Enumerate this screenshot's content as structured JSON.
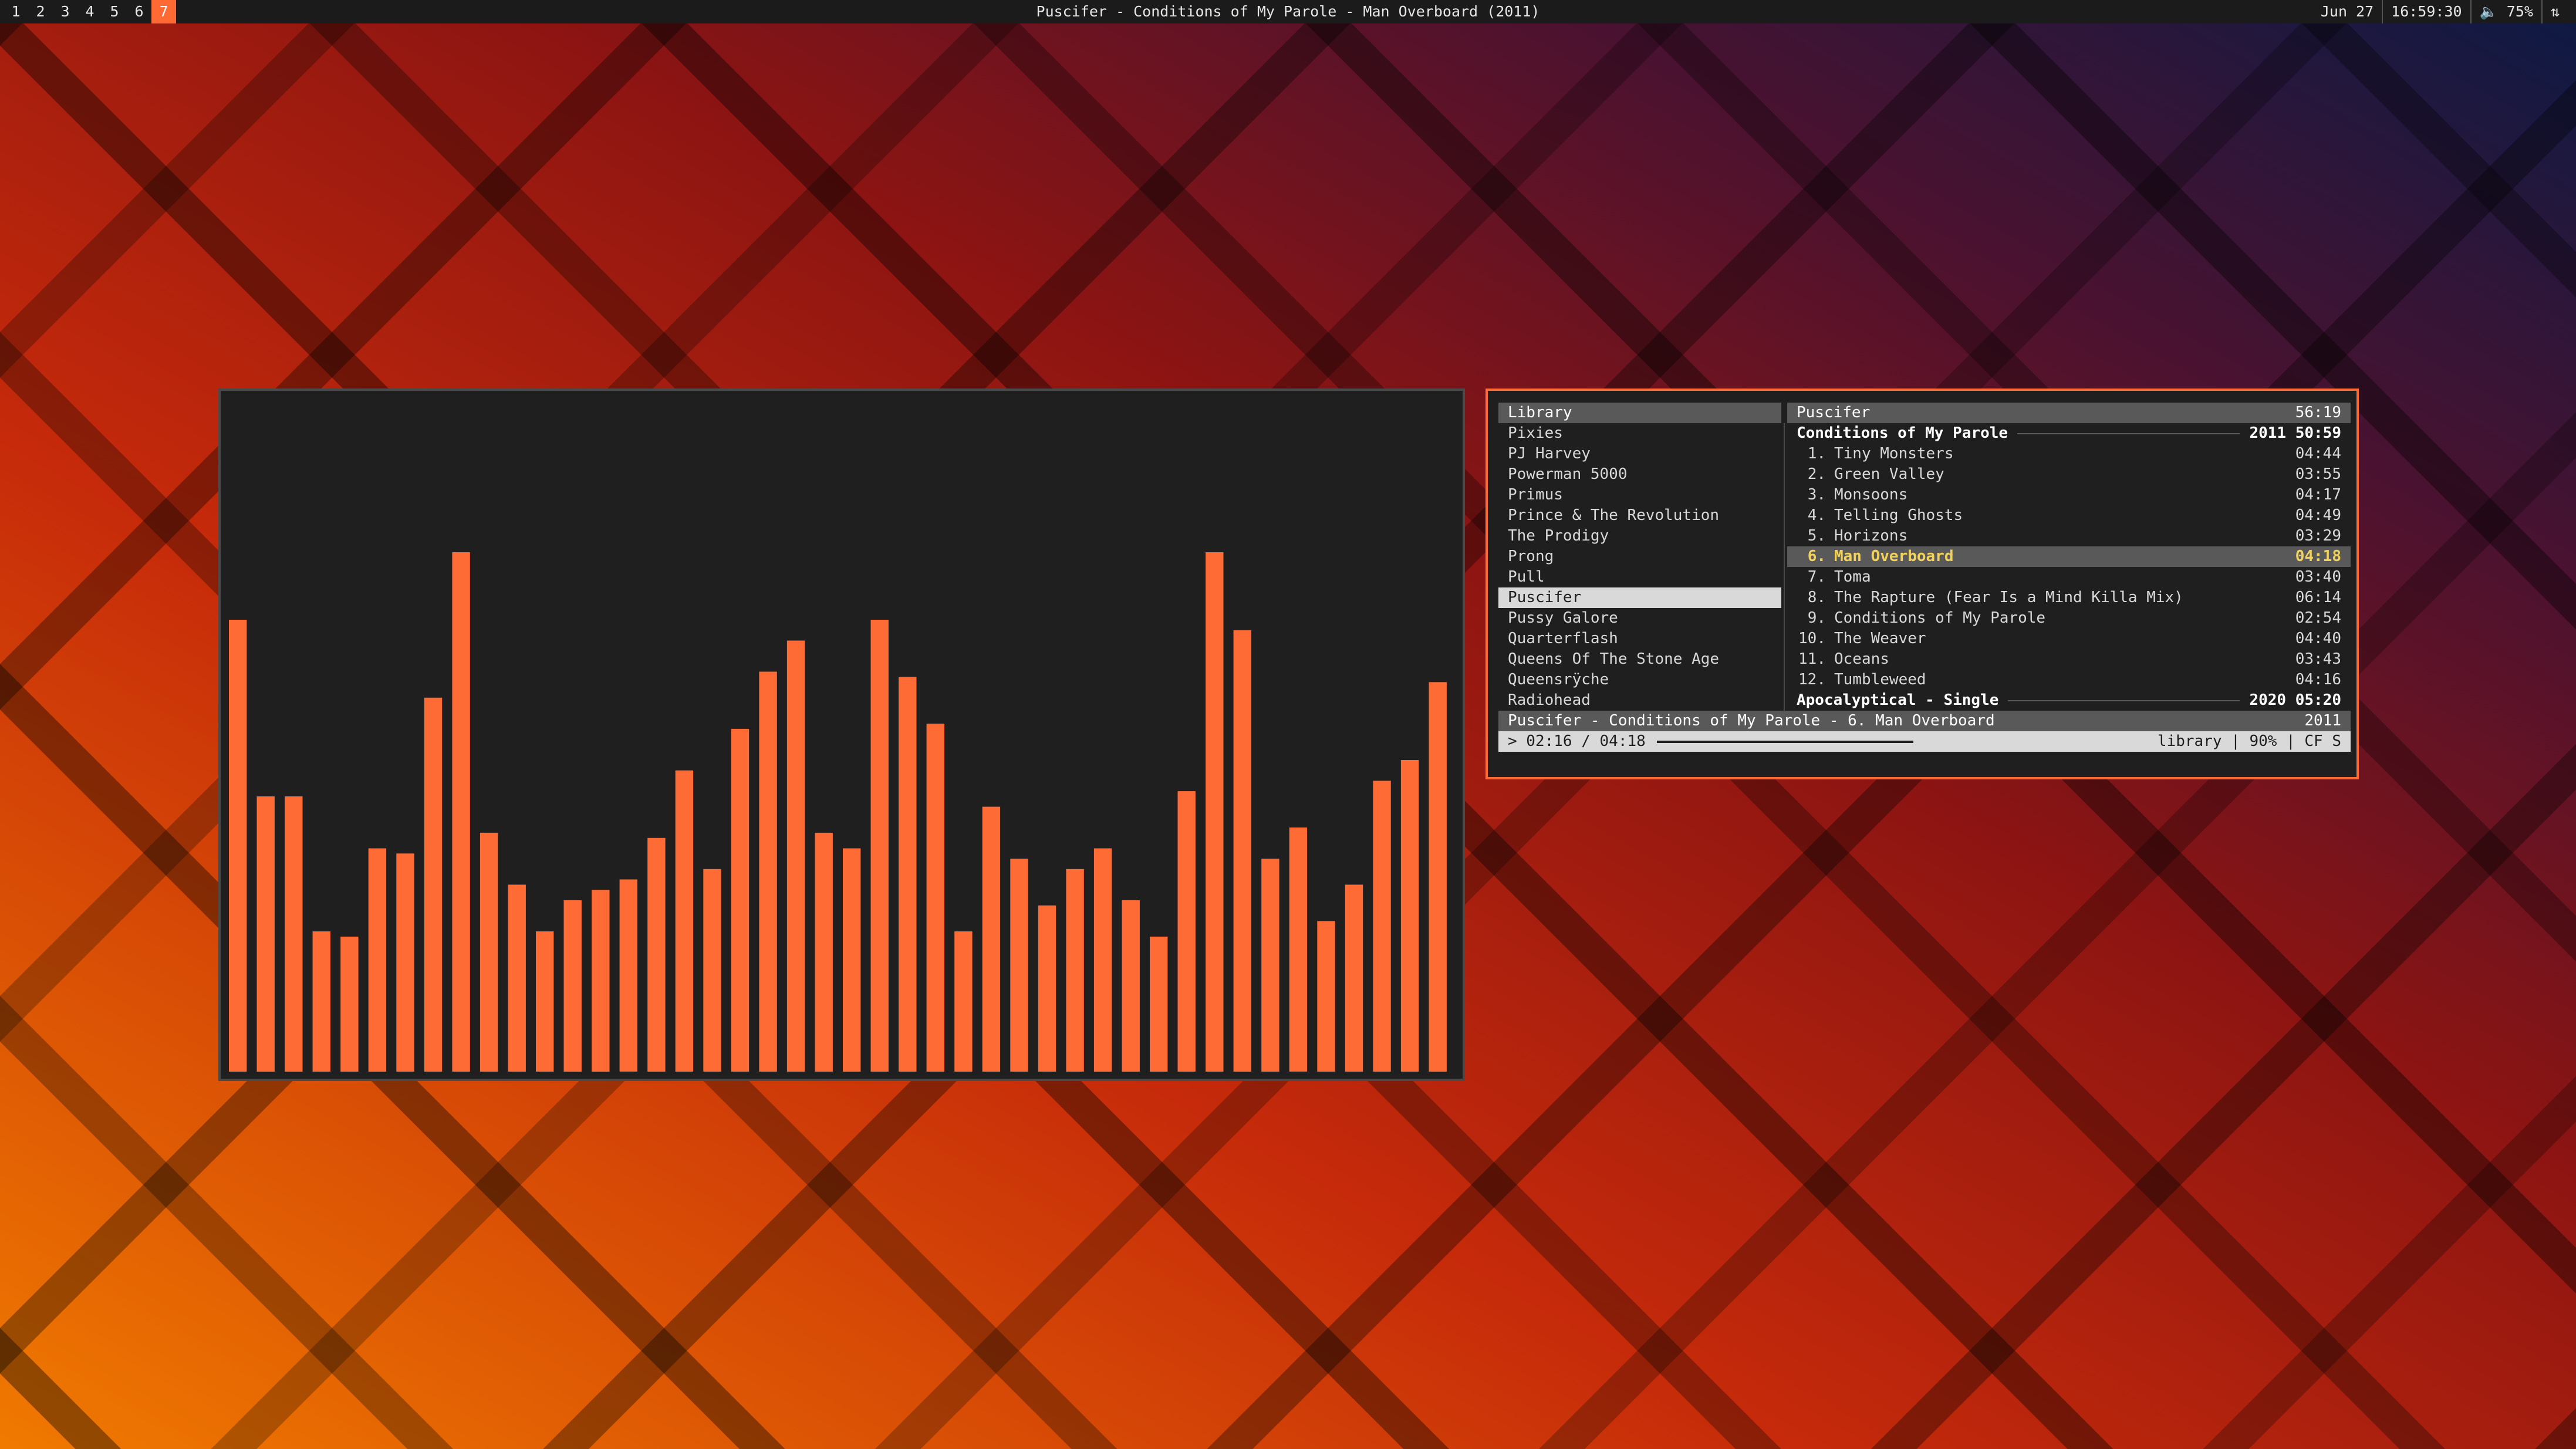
{
  "topbar": {
    "workspaces": [
      "1",
      "2",
      "3",
      "4",
      "5",
      "6",
      "7"
    ],
    "active_workspace": "7",
    "window_title": "Puscifer - Conditions of My Parole - Man Overboard (2011)",
    "date": "Jun 27",
    "time": "16:59:30",
    "volume": "75%",
    "volume_icon": "speaker-icon",
    "tray_icon": "network-icon"
  },
  "colors": {
    "accent": "#ff6a34",
    "bar_color": "#ff6b35",
    "window_bg": "#1f1f1f",
    "highlight": "#f2d25a"
  },
  "visualizer": {
    "bar_levels": [
      0.87,
      0.53,
      0.53,
      0.27,
      0.26,
      0.43,
      0.42,
      0.72,
      1.0,
      0.46,
      0.36,
      0.27,
      0.33,
      0.35,
      0.37,
      0.45,
      0.58,
      0.39,
      0.66,
      0.77,
      0.83,
      0.46,
      0.43,
      0.87,
      0.76,
      0.67,
      0.27,
      0.51,
      0.41,
      0.32,
      0.39,
      0.43,
      0.33,
      0.26,
      0.54,
      1.0,
      0.85,
      0.41,
      0.47,
      0.29,
      0.36,
      0.56,
      0.6,
      0.75
    ]
  },
  "library": {
    "title": "Library",
    "artists": [
      "Pixies",
      "PJ Harvey",
      "Powerman 5000",
      "Primus",
      "Prince & The Revolution",
      "The Prodigy",
      "Prong",
      "Pull",
      "Puscifer",
      "Pussy Galore",
      "Quarterflash",
      "Queens Of The Stone Age",
      "Queensrÿche",
      "Radiohead"
    ],
    "selected": "Puscifer"
  },
  "playlist": {
    "artist": "Puscifer",
    "total_duration": "56:19",
    "albums": [
      {
        "title": "Conditions of My Parole",
        "meta": "2011 50:59",
        "tracks": [
          {
            "num": "1.",
            "title": "Tiny Monsters",
            "duration": "04:44"
          },
          {
            "num": "2.",
            "title": "Green Valley",
            "duration": "03:55"
          },
          {
            "num": "3.",
            "title": "Monsoons",
            "duration": "04:17"
          },
          {
            "num": "4.",
            "title": "Telling Ghosts",
            "duration": "04:49"
          },
          {
            "num": "5.",
            "title": "Horizons",
            "duration": "03:29"
          },
          {
            "num": "6.",
            "title": "Man Overboard",
            "duration": "04:18"
          },
          {
            "num": "7.",
            "title": "Toma",
            "duration": "03:40"
          },
          {
            "num": "8.",
            "title": "The Rapture (Fear Is a Mind Killa Mix)",
            "duration": "06:14"
          },
          {
            "num": "9.",
            "title": "Conditions of My Parole",
            "duration": "02:54"
          },
          {
            "num": "10.",
            "title": "The Weaver",
            "duration": "04:40"
          },
          {
            "num": "11.",
            "title": "Oceans",
            "duration": "03:43"
          },
          {
            "num": "12.",
            "title": "Tumbleweed",
            "duration": "04:16"
          }
        ]
      },
      {
        "title": "Apocalyptical - Single",
        "meta": "2020 05:20"
      }
    ],
    "playing_index": 5
  },
  "statusbar": {
    "now_playing": "Puscifer - Conditions of My Parole - 6. Man Overboard",
    "year": "2011",
    "position": "> 02:16 / 04:18",
    "progress": 0.52,
    "mode": "library | 90% | CF S"
  }
}
